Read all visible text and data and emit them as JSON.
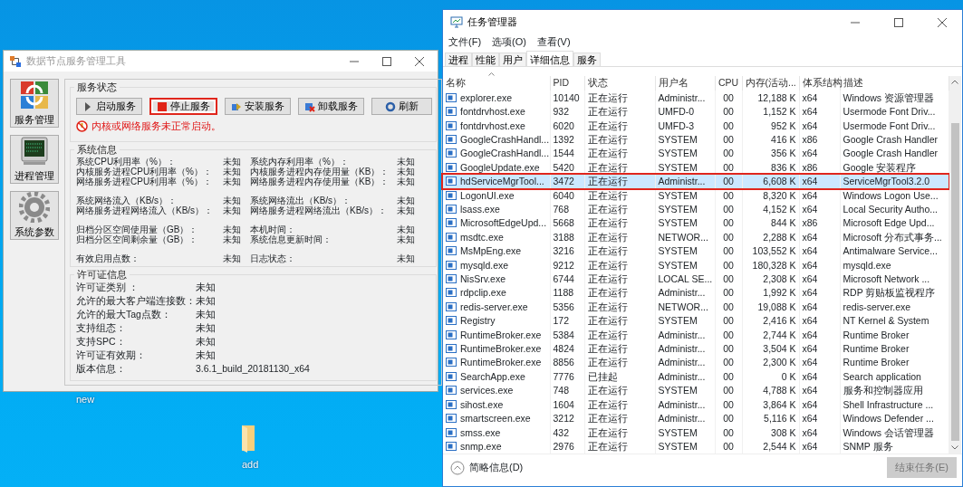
{
  "desktop": {
    "icons": [
      {
        "label": "new"
      },
      {
        "label": "add"
      }
    ]
  },
  "service_tool": {
    "title": "数据节点服务管理工具",
    "sidebar": [
      {
        "label": "服务管理"
      },
      {
        "label": "进程管理"
      },
      {
        "label": "系统参数"
      }
    ],
    "service_status": {
      "title": "服务状态",
      "buttons": [
        {
          "label": "启动服务",
          "annotated": false
        },
        {
          "label": "停止服务",
          "annotated": true
        },
        {
          "label": "安装服务",
          "annotated": false
        },
        {
          "label": "卸载服务",
          "annotated": false
        },
        {
          "label": "刷新",
          "annotated": false
        }
      ],
      "warning": "内核或网络服务未正常启动。"
    },
    "system_info": {
      "title": "系统信息",
      "groups": [
        [
          [
            "系统CPU利用率（%）：",
            "未知",
            "系统内存利用率（%）：",
            "未知"
          ],
          [
            "内核服务进程CPU利用率（%）：",
            "未知",
            "内核服务进程内存使用量（KB）：",
            "未知"
          ],
          [
            "网络服务进程CPU利用率（%）：",
            "未知",
            "网络服务进程内存使用量（KB）：",
            "未知"
          ]
        ],
        [
          [
            "系统网络流入（KB/s）：",
            "未知",
            "系统网络流出（KB/s）：",
            "未知"
          ],
          [
            "网络服务进程网络流入（KB/s）：",
            "未知",
            "网络服务进程网络流出（KB/s）：",
            "未知"
          ]
        ],
        [
          [
            "归档分区空间使用量（GB）：",
            "未知",
            "本机时间：",
            "未知"
          ],
          [
            "归档分区空间剩余量（GB）：",
            "未知",
            "系统信息更新时间：",
            "未知"
          ]
        ],
        [
          [
            "有效启用点数：",
            "未知",
            "日志状态：",
            "未知"
          ]
        ]
      ]
    },
    "license_info": {
      "title": "许可证信息",
      "rows": [
        [
          "许可证类别 ：",
          "未知"
        ],
        [
          "允许的最大客户端连接数：",
          "未知"
        ],
        [
          "允许的最大Tag点数：",
          "未知"
        ],
        [
          "支持组态：",
          "未知"
        ],
        [
          "支持SPC：",
          "未知"
        ],
        [
          "许可证有效期：",
          "未知"
        ],
        [
          "版本信息：",
          "3.6.1_build_20181130_x64"
        ]
      ]
    }
  },
  "task_manager": {
    "title": "任务管理器",
    "menu": [
      "文件(F)",
      "选项(O)",
      "查看(V)"
    ],
    "tabs": [
      {
        "label": "进程",
        "selected": false
      },
      {
        "label": "性能",
        "selected": false
      },
      {
        "label": "用户",
        "selected": false
      },
      {
        "label": "详细信息",
        "selected": true
      },
      {
        "label": "服务",
        "selected": false
      }
    ],
    "table": {
      "columns": [
        "名称",
        "PID",
        "状态",
        "用户名",
        "CPU",
        "内存(活动...",
        "体系结构",
        "描述"
      ],
      "rows": [
        {
          "cells": [
            "explorer.exe",
            "10140",
            "正在运行",
            "Administr...",
            "00",
            "12,188 K",
            "x64",
            "Windows 资源管理器"
          ],
          "selected": false,
          "annotated": false
        },
        {
          "cells": [
            "fontdrvhost.exe",
            "932",
            "正在运行",
            "UMFD-0",
            "00",
            "1,152 K",
            "x64",
            "Usermode Font Driv..."
          ],
          "selected": false,
          "annotated": false
        },
        {
          "cells": [
            "fontdrvhost.exe",
            "6020",
            "正在运行",
            "UMFD-3",
            "00",
            "952 K",
            "x64",
            "Usermode Font Driv..."
          ],
          "selected": false,
          "annotated": false
        },
        {
          "cells": [
            "GoogleCrashHandl...",
            "1392",
            "正在运行",
            "SYSTEM",
            "00",
            "416 K",
            "x86",
            "Google Crash Handler"
          ],
          "selected": false,
          "annotated": false
        },
        {
          "cells": [
            "GoogleCrashHandl...",
            "1544",
            "正在运行",
            "SYSTEM",
            "00",
            "356 K",
            "x64",
            "Google Crash Handler"
          ],
          "selected": false,
          "annotated": false
        },
        {
          "cells": [
            "GoogleUpdate.exe",
            "5420",
            "正在运行",
            "SYSTEM",
            "00",
            "836 K",
            "x86",
            "Google 安装程序"
          ],
          "selected": false,
          "annotated": false
        },
        {
          "cells": [
            "hdServiceMgrTool...",
            "3472",
            "正在运行",
            "Administr...",
            "00",
            "6,608 K",
            "x64",
            "ServiceMgrTool3.2.0"
          ],
          "selected": true,
          "annotated": true
        },
        {
          "cells": [
            "LogonUI.exe",
            "6040",
            "正在运行",
            "SYSTEM",
            "00",
            "8,320 K",
            "x64",
            "Windows Logon Use..."
          ],
          "selected": false,
          "annotated": false
        },
        {
          "cells": [
            "lsass.exe",
            "768",
            "正在运行",
            "SYSTEM",
            "00",
            "4,152 K",
            "x64",
            "Local Security Autho..."
          ],
          "selected": false,
          "annotated": false
        },
        {
          "cells": [
            "MicrosoftEdgeUpd...",
            "5668",
            "正在运行",
            "SYSTEM",
            "00",
            "844 K",
            "x86",
            "Microsoft Edge Upd..."
          ],
          "selected": false,
          "annotated": false
        },
        {
          "cells": [
            "msdtc.exe",
            "3188",
            "正在运行",
            "NETWOR...",
            "00",
            "2,288 K",
            "x64",
            "Microsoft 分布式事务..."
          ],
          "selected": false,
          "annotated": false
        },
        {
          "cells": [
            "MsMpEng.exe",
            "3216",
            "正在运行",
            "SYSTEM",
            "00",
            "103,552 K",
            "x64",
            "Antimalware Service..."
          ],
          "selected": false,
          "annotated": false
        },
        {
          "cells": [
            "mysqld.exe",
            "9212",
            "正在运行",
            "SYSTEM",
            "00",
            "180,328 K",
            "x64",
            "mysqld.exe"
          ],
          "selected": false,
          "annotated": false
        },
        {
          "cells": [
            "NisSrv.exe",
            "6744",
            "正在运行",
            "LOCAL SE...",
            "00",
            "2,308 K",
            "x64",
            "Microsoft Network ..."
          ],
          "selected": false,
          "annotated": false
        },
        {
          "cells": [
            "rdpclip.exe",
            "1188",
            "正在运行",
            "Administr...",
            "00",
            "1,992 K",
            "x64",
            "RDP 剪贴板监视程序"
          ],
          "selected": false,
          "annotated": false
        },
        {
          "cells": [
            "redis-server.exe",
            "5356",
            "正在运行",
            "NETWOR...",
            "00",
            "19,088 K",
            "x64",
            "redis-server.exe"
          ],
          "selected": false,
          "annotated": false
        },
        {
          "cells": [
            "Registry",
            "172",
            "正在运行",
            "SYSTEM",
            "00",
            "2,416 K",
            "x64",
            "NT Kernel & System"
          ],
          "selected": false,
          "annotated": false
        },
        {
          "cells": [
            "RuntimeBroker.exe",
            "5384",
            "正在运行",
            "Administr...",
            "00",
            "2,744 K",
            "x64",
            "Runtime Broker"
          ],
          "selected": false,
          "annotated": false
        },
        {
          "cells": [
            "RuntimeBroker.exe",
            "4824",
            "正在运行",
            "Administr...",
            "00",
            "3,504 K",
            "x64",
            "Runtime Broker"
          ],
          "selected": false,
          "annotated": false
        },
        {
          "cells": [
            "RuntimeBroker.exe",
            "8856",
            "正在运行",
            "Administr...",
            "00",
            "2,300 K",
            "x64",
            "Runtime Broker"
          ],
          "selected": false,
          "annotated": false
        },
        {
          "cells": [
            "SearchApp.exe",
            "7776",
            "已挂起",
            "Administr...",
            "00",
            "0 K",
            "x64",
            "Search application"
          ],
          "selected": false,
          "annotated": false
        },
        {
          "cells": [
            "services.exe",
            "748",
            "正在运行",
            "SYSTEM",
            "00",
            "4,788 K",
            "x64",
            "服务和控制器应用"
          ],
          "selected": false,
          "annotated": false
        },
        {
          "cells": [
            "sihost.exe",
            "1604",
            "正在运行",
            "Administr...",
            "00",
            "3,864 K",
            "x64",
            "Shell Infrastructure ..."
          ],
          "selected": false,
          "annotated": false
        },
        {
          "cells": [
            "smartscreen.exe",
            "3212",
            "正在运行",
            "Administr...",
            "00",
            "5,116 K",
            "x64",
            "Windows Defender ..."
          ],
          "selected": false,
          "annotated": false
        },
        {
          "cells": [
            "smss.exe",
            "432",
            "正在运行",
            "SYSTEM",
            "00",
            "308 K",
            "x64",
            "Windows 会话管理器"
          ],
          "selected": false,
          "annotated": false
        },
        {
          "cells": [
            "snmp.exe",
            "2976",
            "正在运行",
            "SYSTEM",
            "00",
            "2,544 K",
            "x64",
            "SNMP 服务"
          ],
          "selected": false,
          "annotated": false
        }
      ]
    },
    "footer": {
      "details_toggle": "简略信息(D)",
      "end_task_button": {
        "label": "结束任务(E)",
        "disabled": true
      }
    }
  }
}
